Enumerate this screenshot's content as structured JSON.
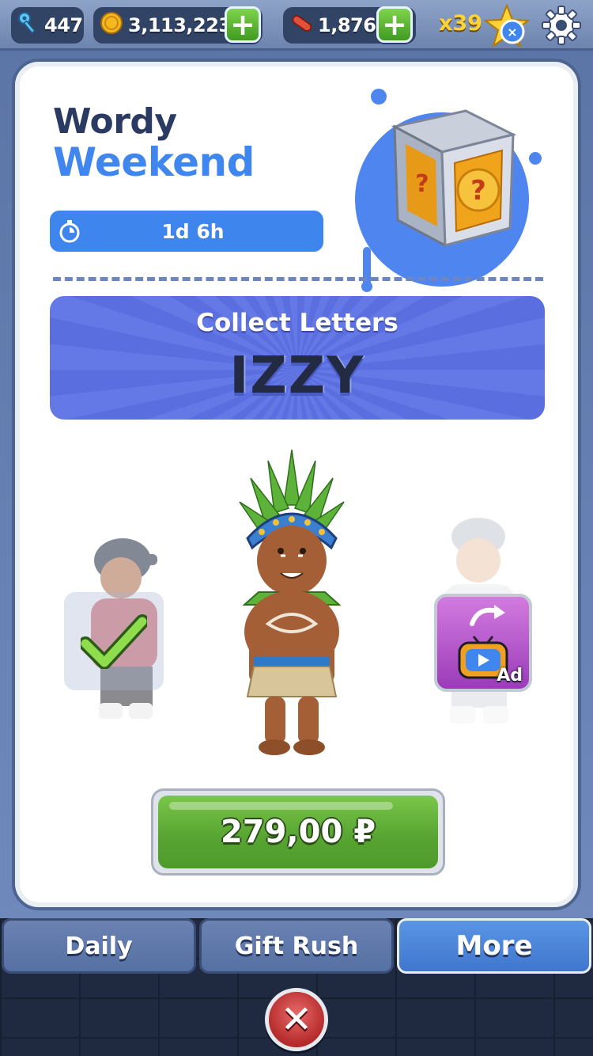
{
  "topbar": {
    "keys": "447",
    "coins": "3,113,223",
    "boards": "1,876",
    "multiplier": "x39",
    "icons": [
      "key-icon",
      "coin-icon",
      "hoverboard-icon",
      "star-icon",
      "gear-icon",
      "plus-icon"
    ]
  },
  "event": {
    "title_line1": "Wordy",
    "title_line2": "Weekend",
    "timer": "1d 6h",
    "banner_title": "Collect Letters",
    "banner_word": "IZZY"
  },
  "offer": {
    "price": "279,00 ₽",
    "ad_label": "Ad"
  },
  "tabs": [
    {
      "label": "Daily",
      "active": false
    },
    {
      "label": "Gift Rush",
      "active": false
    },
    {
      "label": "More",
      "active": true
    }
  ],
  "colors": {
    "accent_blue": "#3f86ee",
    "title_navy": "#2b3a63",
    "buy_green": "#58a533",
    "close_red": "#c43a3a"
  }
}
